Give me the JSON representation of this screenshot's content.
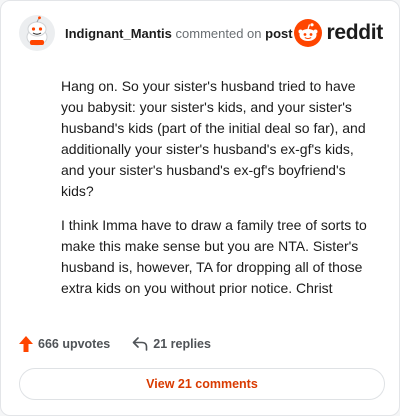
{
  "comment": {
    "username": "Indignant_Mantis",
    "action_text": "commented on",
    "target_text": "post",
    "paragraphs": [
      "Hang on. So your sister's husband tried to have you babysit: your sister's kids, and your sister's husband's kids (part of the initial deal so far), and additionally your sister's husband's ex-gf's kids, and your sister's husband's ex-gf's boyfriend's kids?",
      "I think Imma have to draw a family tree of sorts to make this make sense but you are NTA. Sister's husband is, however, TA for dropping all of those extra kids on you without prior notice. Christ"
    ]
  },
  "brand": {
    "wordmark": "reddit",
    "icon": "reddit-snoo-icon",
    "color": "#ff4500"
  },
  "stats": {
    "upvotes": "666 upvotes",
    "upvote_icon": "arrow-up-icon",
    "upvote_color": "#ff4500",
    "replies": "21 replies",
    "reply_icon": "reply-arrow-icon"
  },
  "view_button": {
    "label": "View 21 comments",
    "color": "#d93a00"
  }
}
